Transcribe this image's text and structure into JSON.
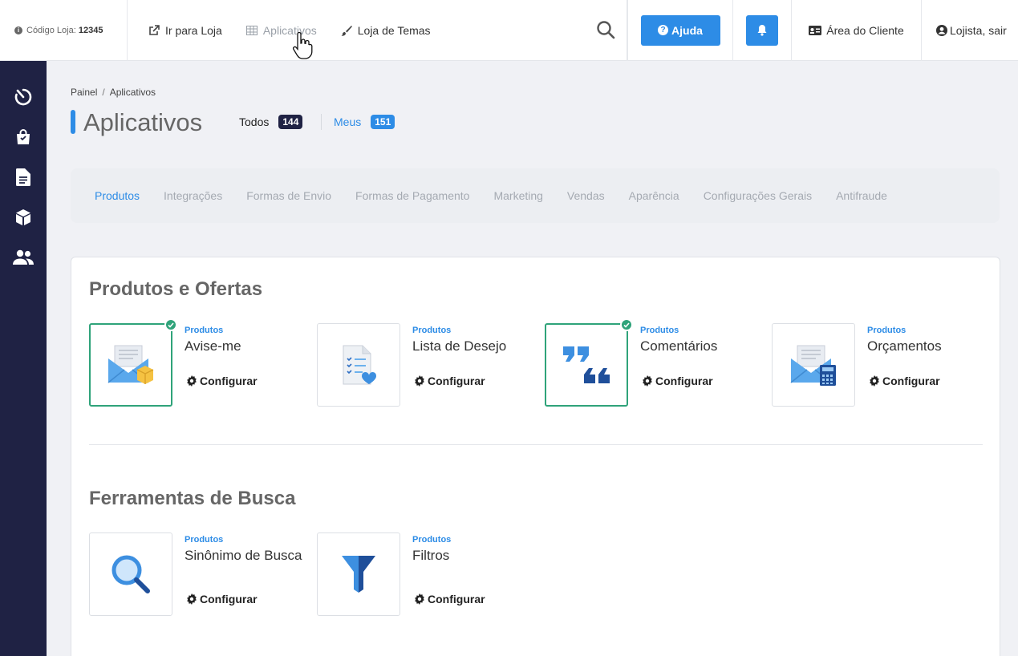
{
  "topbar": {
    "store_code_label": "Código Loja:",
    "store_code_value": "12345",
    "nav": [
      {
        "label": "Ir para Loja",
        "icon": "external-link-icon"
      },
      {
        "label": "Aplicativos",
        "icon": "grid-icon"
      },
      {
        "label": "Loja de Temas",
        "icon": "brush-icon"
      }
    ],
    "help_label": "Ajuda",
    "client_area_label": "Área do Cliente",
    "user_label": "Lojista, sair"
  },
  "sidebar": {
    "icons": [
      "dashboard-icon",
      "shopping-bag-icon",
      "document-icon",
      "box-icon",
      "users-icon"
    ]
  },
  "breadcrumb": [
    "Painel",
    "Aplicativos"
  ],
  "page": {
    "title": "Aplicativos",
    "todos_label": "Todos",
    "todos_count": "144",
    "meus_label": "Meus",
    "meus_count": "151"
  },
  "categories": [
    "Produtos",
    "Integrações",
    "Formas de Envio",
    "Formas de Pagamento",
    "Marketing",
    "Vendas",
    "Aparência",
    "Configurações Gerais",
    "Antifraude"
  ],
  "active_category": "Produtos",
  "sections": [
    {
      "title": "Produtos e Ofertas",
      "apps": [
        {
          "category": "Produtos",
          "name": "Avise-me",
          "action": "Configurar",
          "installed": true,
          "icon": "envelope-box-icon"
        },
        {
          "category": "Produtos",
          "name": "Lista de Desejo",
          "action": "Configurar",
          "installed": false,
          "icon": "checklist-heart-icon"
        },
        {
          "category": "Produtos",
          "name": "Comentários",
          "action": "Configurar",
          "installed": true,
          "icon": "quotes-icon"
        },
        {
          "category": "Produtos",
          "name": "Orçamentos",
          "action": "Configurar",
          "installed": false,
          "icon": "envelope-calculator-icon"
        }
      ]
    },
    {
      "title": "Ferramentas de Busca",
      "apps": [
        {
          "category": "Produtos",
          "name": "Sinônimo de Busca",
          "action": "Configurar",
          "installed": false,
          "icon": "magnifier-icon"
        },
        {
          "category": "Produtos",
          "name": "Filtros",
          "action": "Configurar",
          "installed": false,
          "icon": "funnel-icon"
        }
      ]
    }
  ],
  "colors": {
    "accent": "#2d8ce6",
    "sidebar": "#1f2244",
    "installed": "#2fa37a"
  }
}
